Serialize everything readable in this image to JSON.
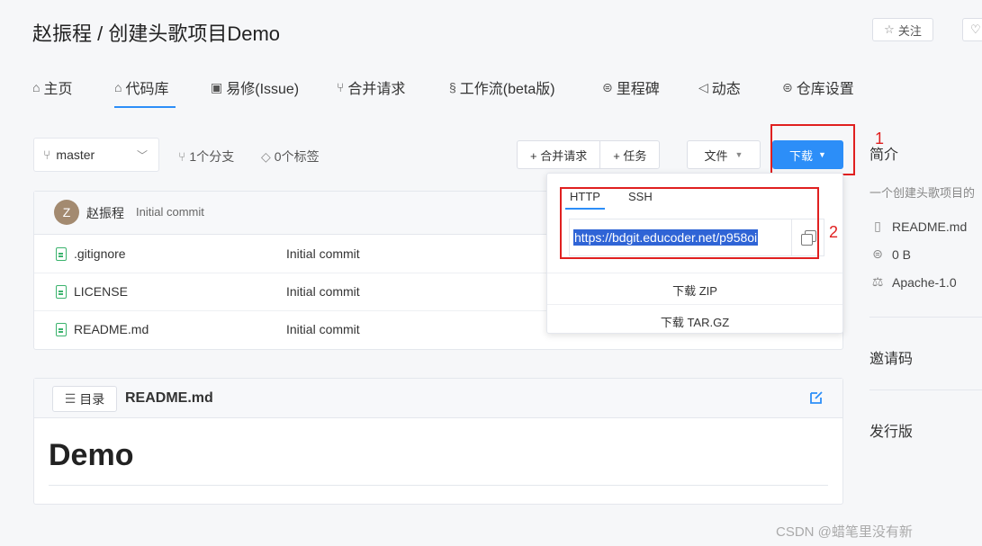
{
  "header": {
    "repo_title": "赵振程 / 创建头歌项目Demo",
    "follow_label": "关注",
    "tabs": [
      {
        "icon": "home-icon",
        "label": "主页"
      },
      {
        "icon": "code-icon",
        "label": "代码库"
      },
      {
        "icon": "issue-icon",
        "label": "易修(Issue)"
      },
      {
        "icon": "merge-icon",
        "label": "合并请求"
      },
      {
        "icon": "workflow-icon",
        "label": "工作流(beta版)"
      },
      {
        "icon": "milestone-icon",
        "label": "里程碑"
      },
      {
        "icon": "activity-icon",
        "label": "动态"
      },
      {
        "icon": "settings-icon",
        "label": "仓库设置"
      }
    ],
    "active_tab": "代码库"
  },
  "toolbar": {
    "branch": "master",
    "branch_count": "1个分支",
    "tag_count": "0个标签",
    "merge_request_label": "+ 合并请求",
    "task_label": "+ 任务",
    "file_label": "文件",
    "download_label": "下载"
  },
  "annotations": {
    "marker_1": "1",
    "marker_2": "2"
  },
  "commit_header": {
    "avatar_letter": "Z",
    "author": "赵振程",
    "message": "Initial commit"
  },
  "files": [
    {
      "name": ".gitignore",
      "commit": "Initial commit"
    },
    {
      "name": "LICENSE",
      "commit": "Initial commit"
    },
    {
      "name": "README.md",
      "commit": "Initial commit"
    }
  ],
  "download_dropdown": {
    "tabs": [
      "HTTP",
      "SSH"
    ],
    "active_tab": "HTTP",
    "url": "https://bdgit.educoder.net/p958oi",
    "download_zip": "下载 ZIP",
    "download_targz": "下载 TAR.GZ"
  },
  "readme": {
    "toc_label": "目录",
    "file_name": "README.md",
    "heading": "Demo"
  },
  "sidebar": {
    "intro_title": "简介",
    "description": "一个创建头歌项目的",
    "items": [
      {
        "icon": "book-icon",
        "label": "README.md"
      },
      {
        "icon": "database-icon",
        "label": "0 B"
      },
      {
        "icon": "scale-icon",
        "label": "Apache-1.0"
      }
    ],
    "invite_title": "邀请码",
    "release_title": "发行版"
  },
  "watermark": "CSDN @蜡笔里没有新",
  "colors": {
    "primary": "#2c8ef8",
    "annotation_red": "#e02020",
    "file_icon_green": "#3bb36d"
  }
}
